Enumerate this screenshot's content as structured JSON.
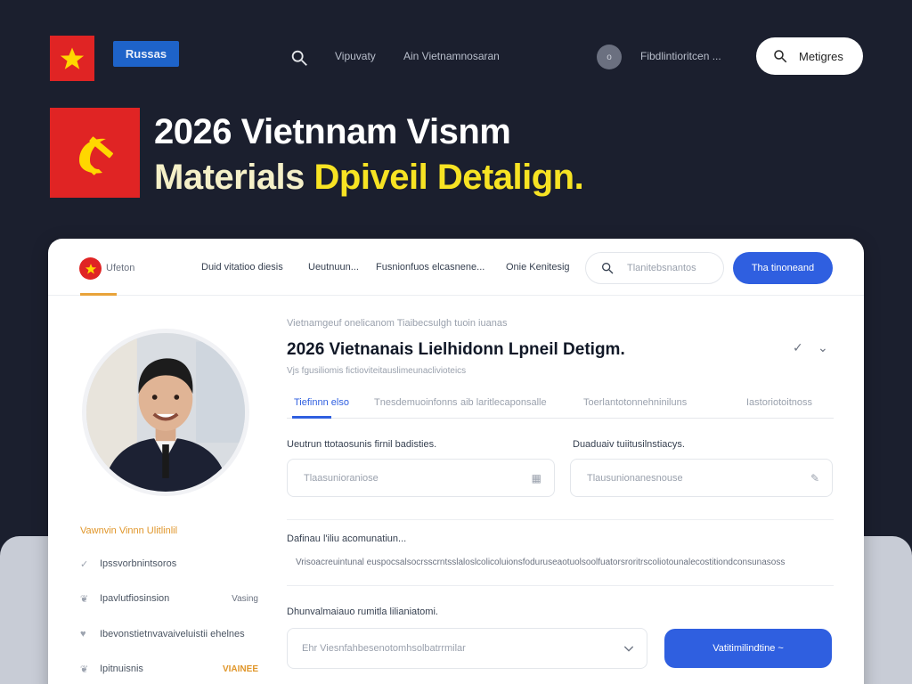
{
  "topbar": {
    "brand_chip": "Russas",
    "links": [
      "Vipuvaty",
      "Ain Vietnamnosaran"
    ],
    "dot_label": "o",
    "account_link": "Fibdlintioritcen ...",
    "pill_label": "Metigres"
  },
  "hero": {
    "line1": "2026 Vietnnam Visnm",
    "line2_part1": "Materials",
    "line2_part2": "Dpiveil Detalign."
  },
  "nav": {
    "brand": "Ufeton",
    "links": [
      "Duid vitatioo diesis",
      "Ueutnuun...",
      "Fusnionfuos elcasnene...",
      "Onie Kenitesig"
    ],
    "search_placeholder": "Tlanitebsnantos",
    "cta_label": "Tha tinoneand"
  },
  "sidebar": {
    "heading": "Vawnvin  Vinnn  Ulitlinlil",
    "items": [
      {
        "icon": "✓",
        "label": "Ipssvorbnintsoros",
        "value": ""
      },
      {
        "icon": "❦",
        "label": "Ipavlutfiosinsion",
        "value": "Vasing"
      },
      {
        "icon": "♥",
        "label": "Ibevonstietnvavaiveluistii ehelnes",
        "value": ""
      },
      {
        "icon": "❦",
        "label": "Ipitnuisnis",
        "value": "VIAINEE"
      }
    ]
  },
  "main": {
    "breadcrumb": "Vietnamgeuf onelicanom  Tiaibecsulgh tuoin  iuanas",
    "title": "2026 Vietnanais Lielhidonn Lpneil Detigm.",
    "subtitle": "Vjs fgusiliomis fictioviteitauslimeunaclivioteics",
    "tabs": [
      "Tiefinnn  elso",
      "Tnesdemuoinfonns",
      "aib laritlecaponsalle",
      "Toerlantotonnehniniluns",
      "Iastoriotoitnoss"
    ],
    "field1_label": "Ueutrun ttotaosunis firnil badisties.",
    "field1_placeholder": "Tlaasunioraniose",
    "field1_icon": "▦",
    "field2_label": "Duaduaiv tuiitusilnstiacys.",
    "field2_placeholder": "Tlausunionanesnouse",
    "field2_icon": "✎",
    "desc_label": "Dafinau l'iliu acomunatiun...",
    "desc_text": "Vrisoacreuintunal euspocsalsocrsscrntsslaloslcolicoluionsfoduruseaotuolsoolfuatorsroritrscoliotounalecostitiondconsunasoss",
    "select_label": "Dhunvalmaiauo rumitla lilianiatomi.",
    "select_placeholder": "Ehr Viesnfahbesenotomhsolbatrrmilar",
    "submit_label": "Vatitimilindtine ~"
  }
}
